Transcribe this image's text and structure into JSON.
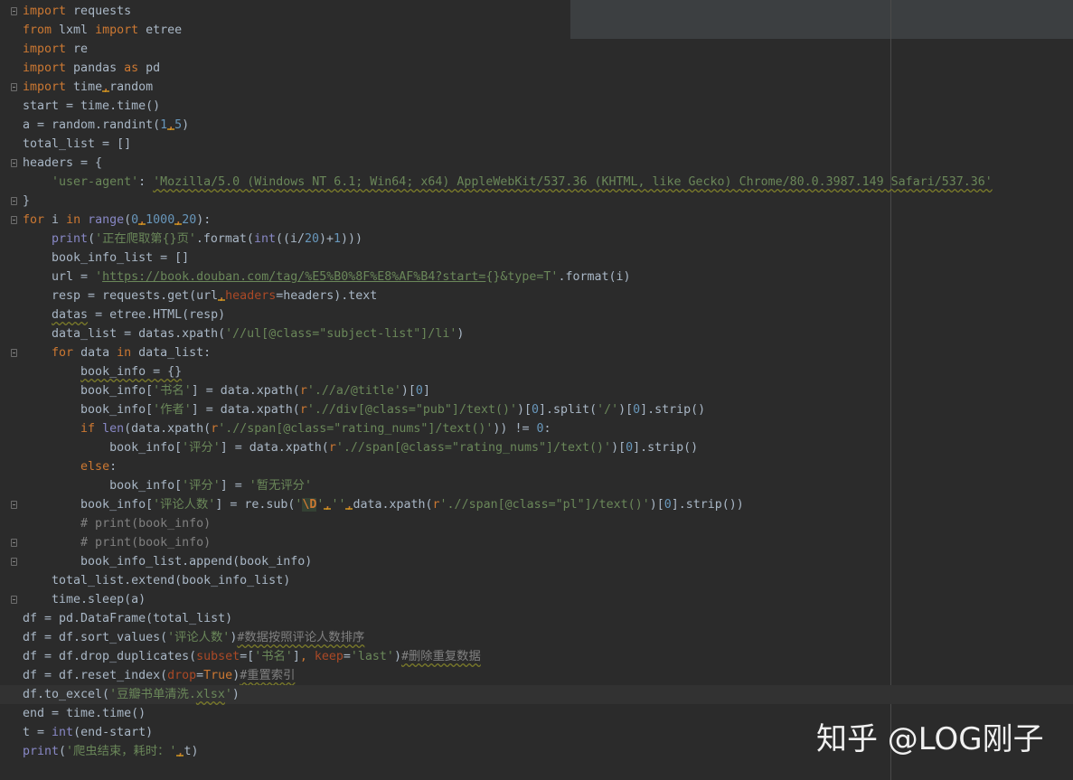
{
  "editor": {
    "background": "#2b2b2b",
    "current_line": 36,
    "lines": [
      [
        {
          "t": "import",
          "c": "kw"
        },
        {
          "t": " requests"
        }
      ],
      [
        {
          "t": "from",
          "c": "kw"
        },
        {
          "t": " lxml "
        },
        {
          "t": "import",
          "c": "kw"
        },
        {
          "t": " etree"
        }
      ],
      [
        {
          "t": "import",
          "c": "kw"
        },
        {
          "t": " re"
        }
      ],
      [
        {
          "t": "import",
          "c": "kw"
        },
        {
          "t": " pandas "
        },
        {
          "t": "as",
          "c": "kw"
        },
        {
          "t": " pd"
        }
      ],
      [
        {
          "t": "import",
          "c": "kw"
        },
        {
          "t": " time"
        },
        {
          "t": ",",
          "c": "warn-comma"
        },
        {
          "t": "random"
        }
      ],
      [
        {
          "t": "start = time.time()"
        }
      ],
      [
        {
          "t": "a = random.randint("
        },
        {
          "t": "1",
          "c": "num"
        },
        {
          "t": ",",
          "c": "warn-comma"
        },
        {
          "t": "5",
          "c": "num"
        },
        {
          "t": ")"
        }
      ],
      [
        {
          "t": "total_list = []"
        }
      ],
      [
        {
          "t": "headers = {"
        }
      ],
      [
        {
          "t": "    "
        },
        {
          "t": "'user-agent'",
          "c": "str"
        },
        {
          "t": ": "
        },
        {
          "t": "'Mozilla/5.0 (Windows NT 6.1; Win64; x64) AppleWebKit/537.36 (KHTML, like Gecko) Chrome/80.0.3987.149 Safari/537.36'",
          "c": "squig-str"
        }
      ],
      [
        {
          "t": "}"
        }
      ],
      [
        {
          "t": "for",
          "c": "kw"
        },
        {
          "t": " i "
        },
        {
          "t": "in",
          "c": "kw"
        },
        {
          "t": " "
        },
        {
          "t": "range",
          "c": "bi"
        },
        {
          "t": "("
        },
        {
          "t": "0",
          "c": "num"
        },
        {
          "t": ",",
          "c": "warn-comma"
        },
        {
          "t": "1000",
          "c": "num"
        },
        {
          "t": ",",
          "c": "warn-comma"
        },
        {
          "t": "20",
          "c": "num"
        },
        {
          "t": "):"
        }
      ],
      [
        {
          "t": "    "
        },
        {
          "t": "print",
          "c": "bi"
        },
        {
          "t": "("
        },
        {
          "t": "'正在爬取第{}页'",
          "c": "str"
        },
        {
          "t": ".format("
        },
        {
          "t": "int",
          "c": "bi"
        },
        {
          "t": "((i/"
        },
        {
          "t": "20",
          "c": "num"
        },
        {
          "t": ")+"
        },
        {
          "t": "1",
          "c": "num"
        },
        {
          "t": ")))"
        }
      ],
      [
        {
          "t": "    book_info_list = []"
        }
      ],
      [
        {
          "t": "    url = "
        },
        {
          "t": "'",
          "c": "str"
        },
        {
          "t": "https://book.douban.com/tag/%E5%B0%8F%E8%AF%B4?start=",
          "c": "link"
        },
        {
          "t": "{}&type=T'",
          "c": "str"
        },
        {
          "t": ".format(i)"
        }
      ],
      [
        {
          "t": "    resp = requests.get(url"
        },
        {
          "t": ",",
          "c": "warn-comma"
        },
        {
          "t": "headers",
          "c": "param"
        },
        {
          "t": "=headers).text"
        }
      ],
      [
        {
          "t": "    "
        },
        {
          "t": "datas",
          "c": "squig"
        },
        {
          "t": " = etree.HTML(resp)"
        }
      ],
      [
        {
          "t": "    data_list = datas.xpath("
        },
        {
          "t": "'//ul[@class=\"subject-list\"]/li'",
          "c": "str"
        },
        {
          "t": ")"
        }
      ],
      [
        {
          "t": "    "
        },
        {
          "t": "for",
          "c": "kw"
        },
        {
          "t": " data "
        },
        {
          "t": "in",
          "c": "kw"
        },
        {
          "t": " data_list:"
        }
      ],
      [
        {
          "t": "        "
        },
        {
          "t": "book_info = {}",
          "c": "squig"
        }
      ],
      [
        {
          "t": "        book_info["
        },
        {
          "t": "'书名'",
          "c": "str"
        },
        {
          "t": "] = data.xpath("
        },
        {
          "t": "r",
          "c": "kw"
        },
        {
          "t": "'.//a/@title'",
          "c": "str"
        },
        {
          "t": ")["
        },
        {
          "t": "0",
          "c": "num"
        },
        {
          "t": "]"
        }
      ],
      [
        {
          "t": "        book_info["
        },
        {
          "t": "'作者'",
          "c": "str"
        },
        {
          "t": "] = data.xpath("
        },
        {
          "t": "r",
          "c": "kw"
        },
        {
          "t": "'.//div[@class=\"pub\"]/text()'",
          "c": "str"
        },
        {
          "t": ")["
        },
        {
          "t": "0",
          "c": "num"
        },
        {
          "t": "].split("
        },
        {
          "t": "'/'",
          "c": "str"
        },
        {
          "t": ")["
        },
        {
          "t": "0",
          "c": "num"
        },
        {
          "t": "].strip()"
        }
      ],
      [
        {
          "t": "        "
        },
        {
          "t": "if",
          "c": "kw"
        },
        {
          "t": " "
        },
        {
          "t": "len",
          "c": "bi"
        },
        {
          "t": "(data.xpath("
        },
        {
          "t": "r",
          "c": "kw"
        },
        {
          "t": "'.//span[@class=\"rating_nums\"]/text()'",
          "c": "str"
        },
        {
          "t": ")) != "
        },
        {
          "t": "0",
          "c": "num"
        },
        {
          "t": ":"
        }
      ],
      [
        {
          "t": "            book_info["
        },
        {
          "t": "'评分'",
          "c": "str"
        },
        {
          "t": "] = data.xpath("
        },
        {
          "t": "r",
          "c": "kw"
        },
        {
          "t": "'.//span[@class=\"rating_nums\"]/text()'",
          "c": "str"
        },
        {
          "t": ")["
        },
        {
          "t": "0",
          "c": "num"
        },
        {
          "t": "].strip()"
        }
      ],
      [
        {
          "t": "        "
        },
        {
          "t": "else",
          "c": "kw"
        },
        {
          "t": ":"
        }
      ],
      [
        {
          "t": "            book_info["
        },
        {
          "t": "'评分'",
          "c": "str"
        },
        {
          "t": "] = "
        },
        {
          "t": "'暂无评分'",
          "c": "str"
        }
      ],
      [
        {
          "t": "        book_info["
        },
        {
          "t": "'评论人数'",
          "c": "str"
        },
        {
          "t": "] = re.sub("
        },
        {
          "t": "'",
          "c": "str"
        },
        {
          "t": "\\D",
          "c": "esc"
        },
        {
          "t": "'",
          "c": "str"
        },
        {
          "t": ",",
          "c": "warn-comma"
        },
        {
          "t": "''",
          "c": "str"
        },
        {
          "t": ",",
          "c": "warn-comma"
        },
        {
          "t": "data.xpath("
        },
        {
          "t": "r",
          "c": "kw"
        },
        {
          "t": "'.//span[@class=\"pl\"]/text()'",
          "c": "str"
        },
        {
          "t": ")["
        },
        {
          "t": "0",
          "c": "num"
        },
        {
          "t": "].strip())"
        }
      ],
      [
        {
          "t": "        "
        },
        {
          "t": "# print(book_info)",
          "c": "cmt"
        }
      ],
      [
        {
          "t": "        "
        },
        {
          "t": "# print(book_info)",
          "c": "cmt"
        }
      ],
      [
        {
          "t": "        book_info_list.append(book_info)"
        }
      ],
      [
        {
          "t": "    total_list.extend(book_info_list)"
        }
      ],
      [
        {
          "t": "    time.sleep(a)"
        }
      ],
      [
        {
          "t": "df = pd.DataFrame(total_list)"
        }
      ],
      [
        {
          "t": "df = df.sort_values("
        },
        {
          "t": "'评论人数'",
          "c": "str"
        },
        {
          "t": ")"
        },
        {
          "t": "#数据按照评论人数排序",
          "c": "cmt squig"
        }
      ],
      [
        {
          "t": "df = df.drop_duplicates("
        },
        {
          "t": "subset",
          "c": "param"
        },
        {
          "t": "=["
        },
        {
          "t": "'书名'",
          "c": "str"
        },
        {
          "t": "]"
        },
        {
          "t": ",",
          "c": "kw"
        },
        {
          "t": " "
        },
        {
          "t": "keep",
          "c": "param"
        },
        {
          "t": "="
        },
        {
          "t": "'last'",
          "c": "str"
        },
        {
          "t": ")"
        },
        {
          "t": "#删除重复数据",
          "c": "cmt squig"
        }
      ],
      [
        {
          "t": "df = df.reset_index("
        },
        {
          "t": "drop",
          "c": "param"
        },
        {
          "t": "="
        },
        {
          "t": "True",
          "c": "kw"
        },
        {
          "t": ")"
        },
        {
          "t": "#重置索引",
          "c": "cmt squig"
        }
      ],
      [
        {
          "t": "df.to_excel("
        },
        {
          "t": "'豆瓣书单清洗.",
          "c": "str"
        },
        {
          "t": "xlsx",
          "c": "squig-str"
        },
        {
          "t": "'",
          "c": "str"
        },
        {
          "t": ")"
        }
      ],
      [
        {
          "t": "end = time.time()"
        }
      ],
      [
        {
          "t": "t = "
        },
        {
          "t": "int",
          "c": "bi"
        },
        {
          "t": "(end-start)"
        }
      ],
      [
        {
          "t": "print",
          "c": "bi"
        },
        {
          "t": "("
        },
        {
          "t": "'爬虫结束，耗时：'",
          "c": "str"
        },
        {
          "t": ",",
          "c": "warn-comma"
        },
        {
          "t": "t)"
        }
      ]
    ],
    "folds": [
      0,
      4,
      8,
      10,
      11,
      18,
      26,
      28,
      29,
      31
    ]
  },
  "watermark": {
    "text": "知乎 @LOG刚子"
  }
}
